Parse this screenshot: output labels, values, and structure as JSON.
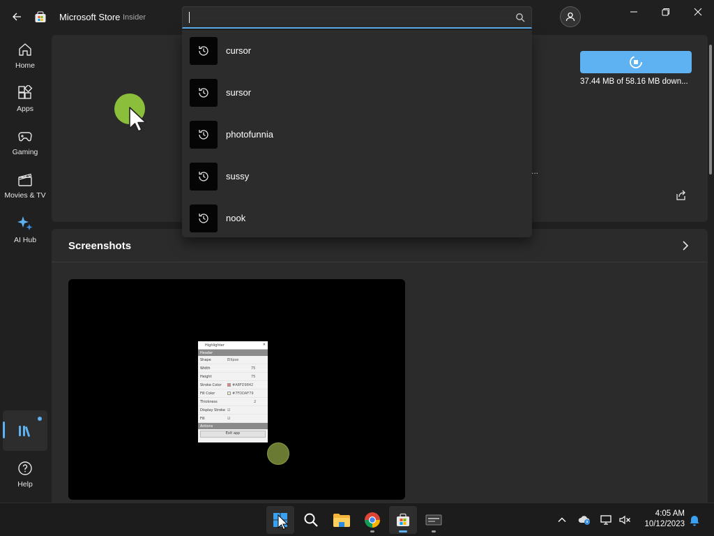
{
  "app": {
    "title": "Microsoft Store",
    "channel": "Insider"
  },
  "search": {
    "value": "",
    "placeholder": ""
  },
  "suggestions": [
    {
      "label": "cursor",
      "icon": "history-icon"
    },
    {
      "label": "sursor",
      "icon": "history-icon"
    },
    {
      "label": "photofunnia",
      "icon": "history-icon"
    },
    {
      "label": "sussy",
      "icon": "history-icon"
    },
    {
      "label": "nook",
      "icon": "history-icon"
    }
  ],
  "sidebar": {
    "items": [
      {
        "label": "Home",
        "icon": "home-icon"
      },
      {
        "label": "Apps",
        "icon": "apps-icon"
      },
      {
        "label": "Gaming",
        "icon": "gamepad-icon"
      },
      {
        "label": "Movies & TV",
        "icon": "clapperboard-icon"
      },
      {
        "label": "AI Hub",
        "icon": "sparkle-icon"
      }
    ],
    "library_icon": "library-icon",
    "help_label": "Help"
  },
  "product": {
    "download_status": "37.44 MB of 58.16 MB down...",
    "truncated_text": "..."
  },
  "screenshots": {
    "title": "Screenshots",
    "preview": {
      "window_title": "Highlighter",
      "section_header": "Header",
      "rows": [
        {
          "label": "Shape",
          "value": "Ellipse"
        },
        {
          "label": "Width",
          "value": "75"
        },
        {
          "label": "Height",
          "value": "75"
        },
        {
          "label": "Stroke Color",
          "value": "#A8FD9842"
        },
        {
          "label": "Fill Color",
          "value": "#7FDDAF79"
        },
        {
          "label": "Thickness",
          "value": "2"
        },
        {
          "label": "Display Stroke",
          "value": ""
        },
        {
          "label": "Fill",
          "value": ""
        }
      ],
      "actions_header": "Actions",
      "exit_button": "Exit app"
    }
  },
  "taskbar": {
    "apps": [
      "start",
      "search",
      "file-explorer",
      "chrome",
      "microsoft-store",
      "highlighter"
    ],
    "time": "4:05 AM",
    "date": "10/12/2023"
  },
  "colors": {
    "accent": "#5fb2f2",
    "background": "#202020",
    "panel": "#2b2b2b",
    "cursor_dot": "#8bbe3a"
  }
}
